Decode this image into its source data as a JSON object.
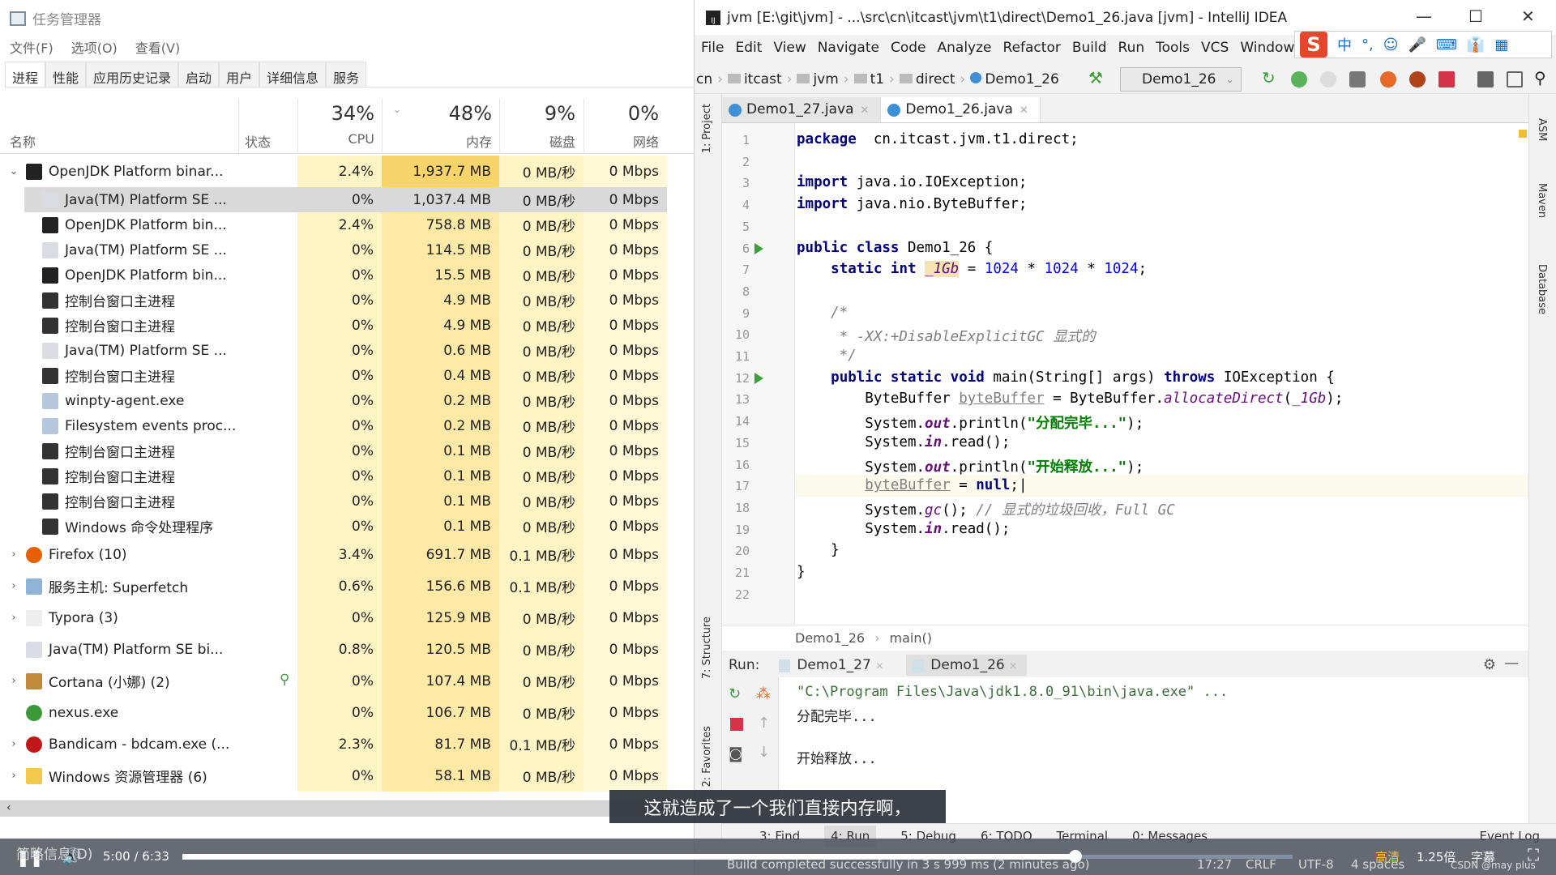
{
  "task_manager": {
    "title": "任务管理器",
    "menu": [
      "文件(F)",
      "选项(O)",
      "查看(V)"
    ],
    "tabs": [
      "进程",
      "性能",
      "应用历史记录",
      "启动",
      "用户",
      "详细信息",
      "服务"
    ],
    "active_tab": "进程",
    "columns": {
      "name": "名称",
      "status": "状态",
      "cpu_pct": "34%",
      "cpu": "CPU",
      "mem_pct": "48%",
      "mem": "内存",
      "disk_pct": "9%",
      "disk": "磁盘",
      "net_pct": "0%",
      "net": "网络"
    },
    "rows": [
      {
        "name": "OpenJDK Platform binar...",
        "icon": "jb-icon",
        "cpu": "2.4%",
        "mem": "1,937.7 MB",
        "disk": "0 MB/秒",
        "net": "0 Mbps",
        "expand": "open",
        "indent": 0
      },
      {
        "name": "Java(TM) Platform SE ...",
        "icon": "java-icon",
        "cpu": "0%",
        "mem": "1,037.4 MB",
        "disk": "0 MB/秒",
        "net": "0 Mbps",
        "indent": 1,
        "selected": true
      },
      {
        "name": "OpenJDK Platform bin...",
        "icon": "jb-icon",
        "cpu": "2.4%",
        "mem": "758.8 MB",
        "disk": "0 MB/秒",
        "net": "0 Mbps",
        "indent": 1
      },
      {
        "name": "Java(TM) Platform SE ...",
        "icon": "java-icon",
        "cpu": "0%",
        "mem": "114.5 MB",
        "disk": "0 MB/秒",
        "net": "0 Mbps",
        "indent": 1
      },
      {
        "name": "OpenJDK Platform bin...",
        "icon": "jb-icon",
        "cpu": "0%",
        "mem": "15.5 MB",
        "disk": "0 MB/秒",
        "net": "0 Mbps",
        "indent": 1
      },
      {
        "name": "控制台窗口主进程",
        "icon": "console-icon",
        "cpu": "0%",
        "mem": "4.9 MB",
        "disk": "0 MB/秒",
        "net": "0 Mbps",
        "indent": 1
      },
      {
        "name": "控制台窗口主进程",
        "icon": "console-icon",
        "cpu": "0%",
        "mem": "4.9 MB",
        "disk": "0 MB/秒",
        "net": "0 Mbps",
        "indent": 1
      },
      {
        "name": "Java(TM) Platform SE ...",
        "icon": "java-icon",
        "cpu": "0%",
        "mem": "0.6 MB",
        "disk": "0 MB/秒",
        "net": "0 Mbps",
        "indent": 1
      },
      {
        "name": "控制台窗口主进程",
        "icon": "console-icon",
        "cpu": "0%",
        "mem": "0.4 MB",
        "disk": "0 MB/秒",
        "net": "0 Mbps",
        "indent": 1
      },
      {
        "name": "winpty-agent.exe",
        "icon": "app-icon",
        "cpu": "0%",
        "mem": "0.2 MB",
        "disk": "0 MB/秒",
        "net": "0 Mbps",
        "indent": 1
      },
      {
        "name": "Filesystem events proc...",
        "icon": "app-icon",
        "cpu": "0%",
        "mem": "0.2 MB",
        "disk": "0 MB/秒",
        "net": "0 Mbps",
        "indent": 1
      },
      {
        "name": "控制台窗口主进程",
        "icon": "console-icon",
        "cpu": "0%",
        "mem": "0.1 MB",
        "disk": "0 MB/秒",
        "net": "0 Mbps",
        "indent": 1
      },
      {
        "name": "控制台窗口主进程",
        "icon": "console-icon",
        "cpu": "0%",
        "mem": "0.1 MB",
        "disk": "0 MB/秒",
        "net": "0 Mbps",
        "indent": 1
      },
      {
        "name": "控制台窗口主进程",
        "icon": "console-icon",
        "cpu": "0%",
        "mem": "0.1 MB",
        "disk": "0 MB/秒",
        "net": "0 Mbps",
        "indent": 1
      },
      {
        "name": "Windows 命令处理程序",
        "icon": "console-icon",
        "cpu": "0%",
        "mem": "0.1 MB",
        "disk": "0 MB/秒",
        "net": "0 Mbps",
        "indent": 1
      },
      {
        "name": "Firefox (10)",
        "icon": "firefox-icon",
        "cpu": "3.4%",
        "mem": "691.7 MB",
        "disk": "0.1 MB/秒",
        "net": "0 Mbps",
        "expand": "closed",
        "indent": 0
      },
      {
        "name": "服务主机: Superfetch",
        "icon": "gear-icon",
        "cpu": "0.6%",
        "mem": "156.6 MB",
        "disk": "0.1 MB/秒",
        "net": "0 Mbps",
        "expand": "closed",
        "indent": 0
      },
      {
        "name": "Typora (3)",
        "icon": "typora-icon",
        "cpu": "0%",
        "mem": "125.9 MB",
        "disk": "0 MB/秒",
        "net": "0 Mbps",
        "expand": "closed",
        "indent": 0
      },
      {
        "name": "Java(TM) Platform SE bi...",
        "icon": "java-icon",
        "cpu": "0.8%",
        "mem": "120.5 MB",
        "disk": "0 MB/秒",
        "net": "0 Mbps",
        "indent": 0
      },
      {
        "name": "Cortana (小娜) (2)",
        "icon": "cortana-icon",
        "cpu": "0%",
        "mem": "107.4 MB",
        "disk": "0 MB/秒",
        "net": "0 Mbps",
        "expand": "closed",
        "indent": 0,
        "pin": true
      },
      {
        "name": "nexus.exe",
        "icon": "nexus-icon",
        "cpu": "0%",
        "mem": "106.7 MB",
        "disk": "0 MB/秒",
        "net": "0 Mbps",
        "indent": 0
      },
      {
        "name": "Bandicam - bdcam.exe (...",
        "icon": "bandicam-icon",
        "cpu": "2.3%",
        "mem": "81.7 MB",
        "disk": "0.1 MB/秒",
        "net": "0 Mbps",
        "expand": "closed",
        "indent": 0
      },
      {
        "name": "Windows 资源管理器 (6)",
        "icon": "explorer-icon",
        "cpu": "0%",
        "mem": "58.1 MB",
        "disk": "0 MB/秒",
        "net": "0 Mbps",
        "expand": "closed",
        "indent": 0
      }
    ],
    "brief": "简略信息(D)"
  },
  "idea": {
    "title": "jvm [E:\\git\\jvm] - ...\\src\\cn\\itcast\\jvm\\t1\\direct\\Demo1_26.java [jvm] - IntelliJ IDEA",
    "menu": [
      "File",
      "Edit",
      "View",
      "Navigate",
      "Code",
      "Analyze",
      "Refactor",
      "Build",
      "Run",
      "Tools",
      "VCS",
      "Window"
    ],
    "ime": [
      "中",
      "°,",
      "☺",
      "🎤",
      "⌨",
      "👔",
      "▦"
    ],
    "breadcrumb": [
      "cn",
      "itcast",
      "jvm",
      "t1",
      "direct",
      "Demo1_26"
    ],
    "run_config": "Demo1_26",
    "file_tabs": [
      {
        "label": "Demo1_27.java",
        "active": false
      },
      {
        "label": "Demo1_26.java",
        "active": true
      }
    ],
    "left_tools": [
      "1: Project",
      "7: Structure",
      "2: Favorites"
    ],
    "right_tools": [
      "ASM",
      "Maven",
      "Database"
    ],
    "code": [
      [
        [
          "kw",
          "package"
        ],
        [
          "",
          "  cn.itcast.jvm.t1.direct;"
        ]
      ],
      [],
      [
        [
          "kw",
          "import"
        ],
        [
          "",
          " java.io.IOException;"
        ]
      ],
      [
        [
          "kw",
          "import"
        ],
        [
          "",
          " java.nio.ByteBuffer;"
        ]
      ],
      [],
      [
        [
          "kw",
          "public class"
        ],
        [
          "",
          " Demo1_26 {"
        ]
      ],
      [
        [
          "",
          "    "
        ],
        [
          "kw",
          "static int"
        ],
        [
          "",
          " "
        ],
        [
          "fld hl",
          "_1Gb"
        ],
        [
          "",
          " = "
        ],
        [
          "num",
          "1024"
        ],
        [
          "",
          " * "
        ],
        [
          "num",
          "1024"
        ],
        [
          "",
          " * "
        ],
        [
          "num",
          "1024"
        ],
        [
          "",
          ";"
        ]
      ],
      [],
      [
        [
          "cm",
          "    /*"
        ]
      ],
      [
        [
          "cm",
          "     * -XX:+DisableExplicitGC 显式的"
        ]
      ],
      [
        [
          "cm",
          "     */"
        ]
      ],
      [
        [
          "",
          "    "
        ],
        [
          "kw",
          "public static void"
        ],
        [
          "",
          " main(String[] args) "
        ],
        [
          "kw",
          "throws"
        ],
        [
          "",
          " IOException {"
        ]
      ],
      [
        [
          "",
          "        ByteBuffer "
        ],
        [
          "unused",
          "byteBuffer"
        ],
        [
          "",
          " = ByteBuffer."
        ],
        [
          "fld",
          "allocateDirect"
        ],
        [
          "",
          "("
        ],
        [
          "fld",
          "_1Gb"
        ],
        [
          "",
          ");"
        ]
      ],
      [
        [
          "",
          "        System."
        ],
        [
          "fldb",
          "out"
        ],
        [
          "",
          ".println("
        ],
        [
          "str",
          "\"分配完毕...\""
        ],
        [
          "",
          ");"
        ]
      ],
      [
        [
          "",
          "        System."
        ],
        [
          "fldb",
          "in"
        ],
        [
          "",
          ".read();"
        ]
      ],
      [
        [
          "",
          "        System."
        ],
        [
          "fldb",
          "out"
        ],
        [
          "",
          ".println("
        ],
        [
          "str",
          "\"开始释放...\""
        ],
        [
          "",
          ");"
        ]
      ],
      [
        [
          "",
          "        "
        ],
        [
          "unused",
          "byteBuffer"
        ],
        [
          "",
          " = "
        ],
        [
          "kw",
          "null"
        ],
        [
          "",
          ";"
        ]
      ],
      [
        [
          "",
          "        System."
        ],
        [
          "fld",
          "gc"
        ],
        [
          "",
          "(); "
        ],
        [
          "cm",
          "// 显式的垃圾回收，Full GC"
        ]
      ],
      [
        [
          "",
          "        System."
        ],
        [
          "fldb",
          "in"
        ],
        [
          "",
          ".read();"
        ]
      ],
      [
        [
          "",
          "    }"
        ]
      ],
      [
        [
          "",
          "}"
        ]
      ],
      []
    ],
    "editor_breadcrumb": [
      "Demo1_26",
      "main()"
    ],
    "run": {
      "label": "Run:",
      "tabs": [
        {
          "label": "Demo1_27",
          "active": false
        },
        {
          "label": "Demo1_26",
          "active": true
        }
      ],
      "output": [
        "\"C:\\Program Files\\Java\\jdk1.8.0_91\\bin\\java.exe\" ...",
        "分配完毕...",
        "",
        "开始释放..."
      ]
    },
    "tool_tabs": [
      "3: Find",
      "4: Run",
      "5: Debug",
      "6: TODO",
      "Terminal",
      "0: Messages"
    ],
    "active_tool_tab": "4: Run",
    "event_log": "Event Log",
    "status": {
      "message": "Build completed successfully in 3 s 999 ms (2 minutes ago)",
      "position": "17:27",
      "line_sep": "CRLF",
      "encoding": "UTF-8",
      "indent": "4 spaces"
    }
  },
  "video": {
    "subtitle": "这就造成了一个我们直接内存啊，",
    "time": "5:00 / 6:33",
    "progress": 0.764,
    "buffered": 0.95,
    "quality": "高清",
    "speed": "1.25倍",
    "captions": "字幕",
    "watermark": "CSDN @may plus"
  },
  "colors": {
    "cpu_heat": "#fff4c4",
    "mem_heat": "#ffe9a6",
    "mem_hot": "#f8d46a",
    "accent_green": "#3aa13a"
  }
}
